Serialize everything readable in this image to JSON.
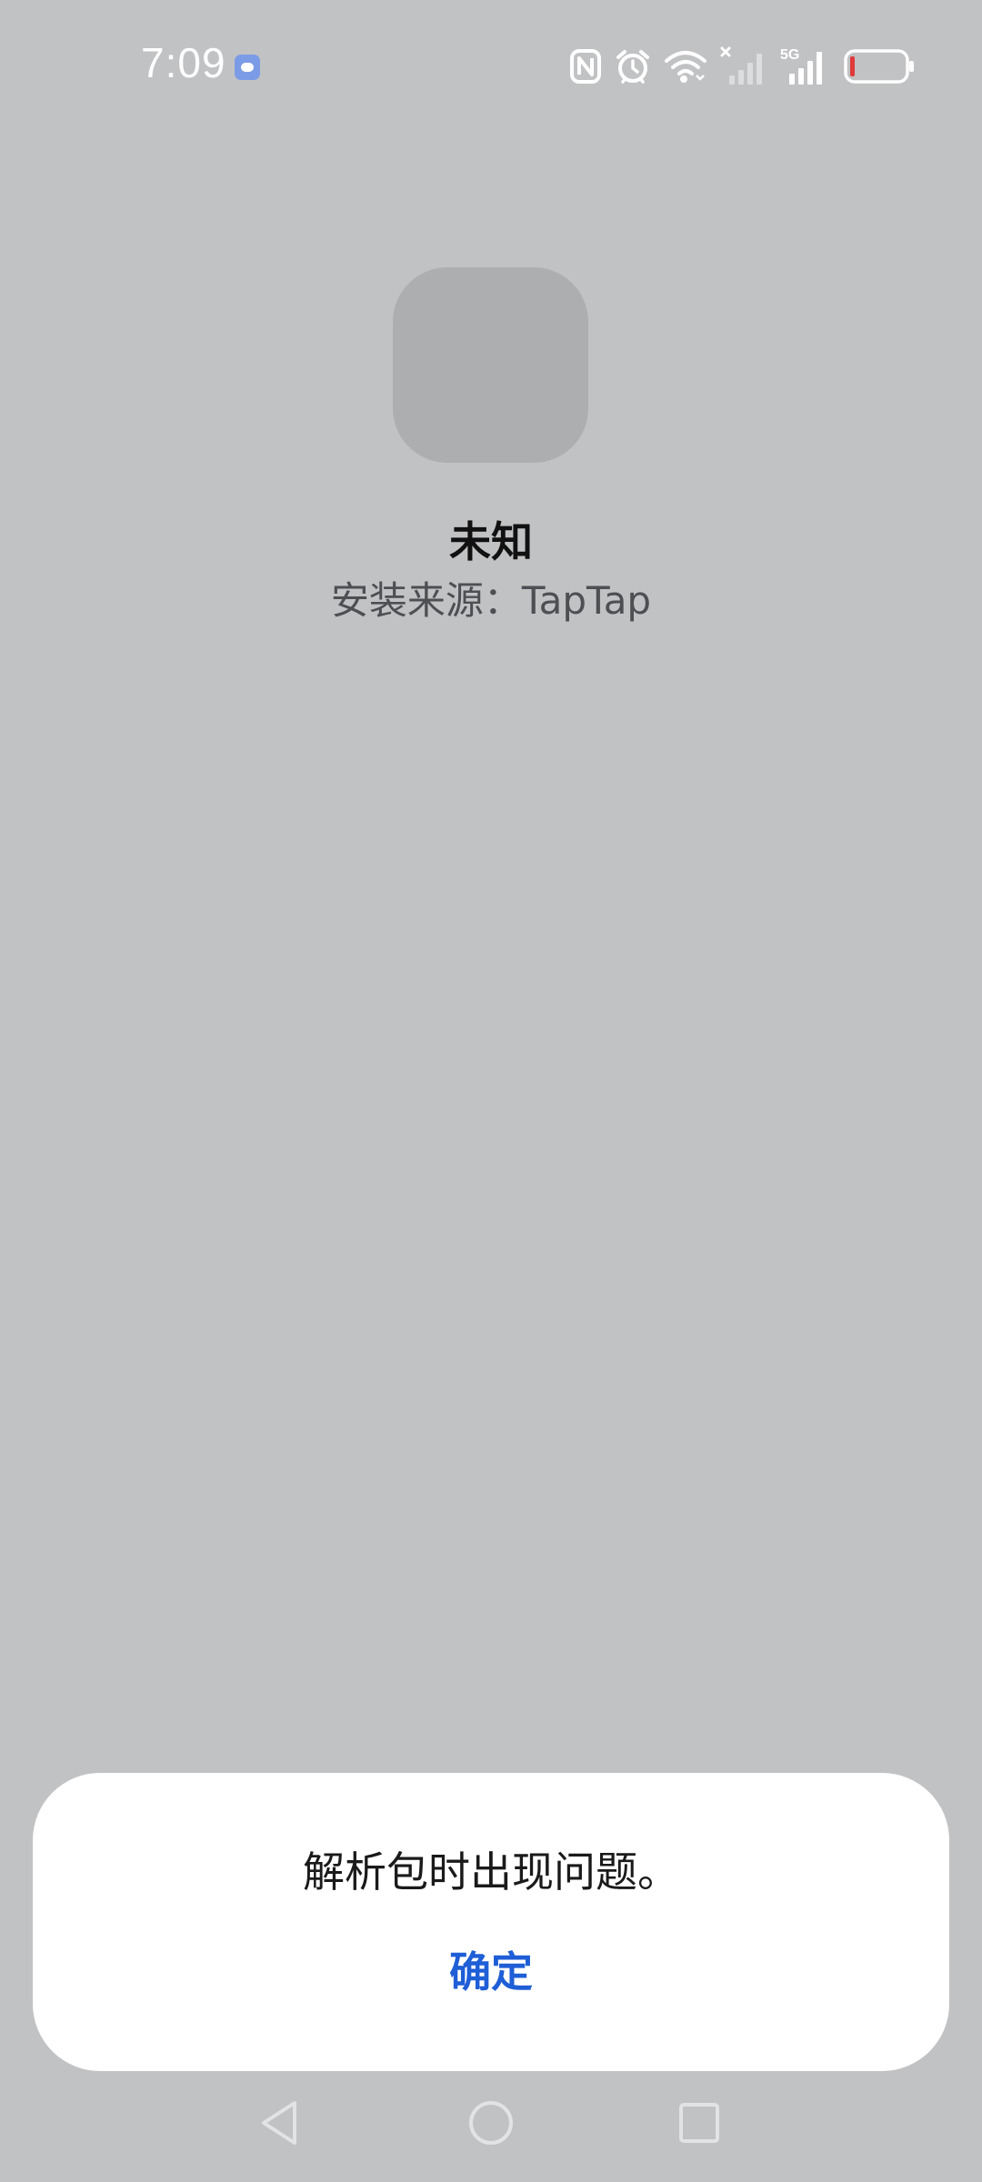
{
  "status_bar": {
    "time": "7:09",
    "network_label": "5G",
    "icons": [
      "app-notification-icon",
      "nfc-icon",
      "alarm-icon",
      "wifi-icon",
      "sim-no-signal-icon",
      "signal-5g-icon",
      "battery-icon"
    ],
    "battery_color": "#e03a3a"
  },
  "app": {
    "name": "未知",
    "install_source": "安装来源：TapTap"
  },
  "dialog": {
    "message": "解析包时出现问题。",
    "confirm_label": "确定",
    "accent_color": "#1e5ed6"
  },
  "nav": {
    "icons": [
      "back-icon",
      "home-icon",
      "recents-icon"
    ]
  }
}
